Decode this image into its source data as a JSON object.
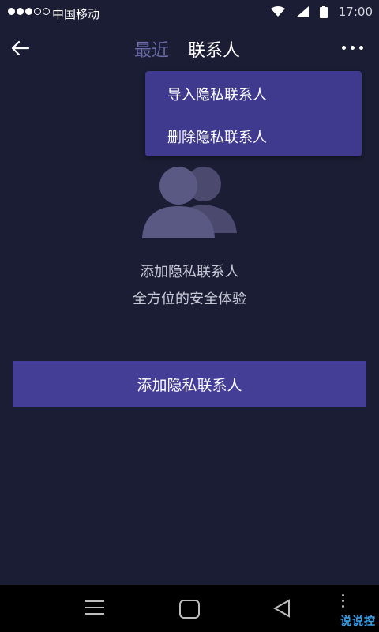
{
  "status": {
    "carrier": "中国移动",
    "time": "17:00"
  },
  "header": {
    "tab_recent": "最近",
    "tab_contacts": "联系人"
  },
  "menu": {
    "items": [
      "导入隐私联系人",
      "删除隐私联系人"
    ]
  },
  "empty_state": {
    "line1": "添加隐私联系人",
    "line2": "全方位的安全体验"
  },
  "main": {
    "add_button": "添加隐私联系人"
  },
  "watermark": "说说控",
  "colors": {
    "background": "#1a1d33",
    "accent": "#453e97",
    "menu_bg": "#3f3a8e",
    "inactive_tab": "#6c6aa8"
  }
}
